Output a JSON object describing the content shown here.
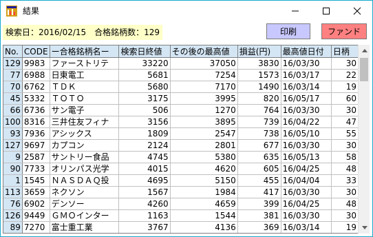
{
  "window": {
    "title": "結果",
    "icon": "app-grid-icon"
  },
  "header": {
    "label": "検索日：2016/02/15　合格銘柄数：129"
  },
  "buttons": {
    "print": "印刷",
    "fund": "ファンド"
  },
  "colors": {
    "header_bg": "#ffffc8",
    "print_btn": "#c8c8ff",
    "fund_btn": "#ff8080",
    "grid_header": "#d4e6f4",
    "window_border": "#17a9cf"
  },
  "table": {
    "columns": [
      "No.",
      "CODE",
      "ー合格銘柄名ー",
      "検索日終値",
      "その後の最高値",
      "損益(円)",
      "最高値日付",
      "日柄"
    ],
    "rows": [
      [
        "129",
        "9983",
        "ファーストリテ",
        "33220",
        "37050",
        "3830",
        "16/03/30",
        "30"
      ],
      [
        "77",
        "6988",
        "日東電工",
        "5681",
        "7254",
        "1573",
        "16/03/17",
        "22"
      ],
      [
        "70",
        "6762",
        "ＴＤＫ",
        "5680",
        "7170",
        "1490",
        "16/03/14",
        "19"
      ],
      [
        "45",
        "5332",
        "ＴＯＴＯ",
        "3175",
        "3995",
        "820",
        "16/05/17",
        "60"
      ],
      [
        "66",
        "6736",
        "サン電子",
        "506",
        "1270",
        "764",
        "16/03/30",
        "30"
      ],
      [
        "100",
        "8316",
        "三井住友フィナ",
        "3156",
        "3895",
        "739",
        "16/04/22",
        "47"
      ],
      [
        "93",
        "7936",
        "アシックス",
        "1809",
        "2547",
        "738",
        "16/05/10",
        "55"
      ],
      [
        "127",
        "9697",
        "カプコン",
        "2124",
        "2801",
        "677",
        "16/03/30",
        "30"
      ],
      [
        "9",
        "2587",
        "サントリー食品",
        "4745",
        "5380",
        "635",
        "16/05/13",
        "58"
      ],
      [
        "90",
        "7733",
        "オリンパス光学",
        "4015",
        "4620",
        "605",
        "16/04/25",
        "48"
      ],
      [
        "1",
        "1545",
        "ＮＡＳＤＡＱ投",
        "4695",
        "5150",
        "455",
        "16/04/04",
        "33"
      ],
      [
        "113",
        "3659",
        "ネクソン",
        "1567",
        "1984",
        "417",
        "16/03/30",
        "30"
      ],
      [
        "76",
        "6902",
        "デンソー",
        "4260",
        "4659",
        "399",
        "16/04/25",
        "48"
      ],
      [
        "126",
        "9449",
        "ＧＭＯインター",
        "1163",
        "1544",
        "381",
        "16/03/30",
        "30"
      ],
      [
        "89",
        "7270",
        "富士重工業",
        "3767",
        "4136",
        "369",
        "16/03/14",
        "19"
      ]
    ]
  }
}
